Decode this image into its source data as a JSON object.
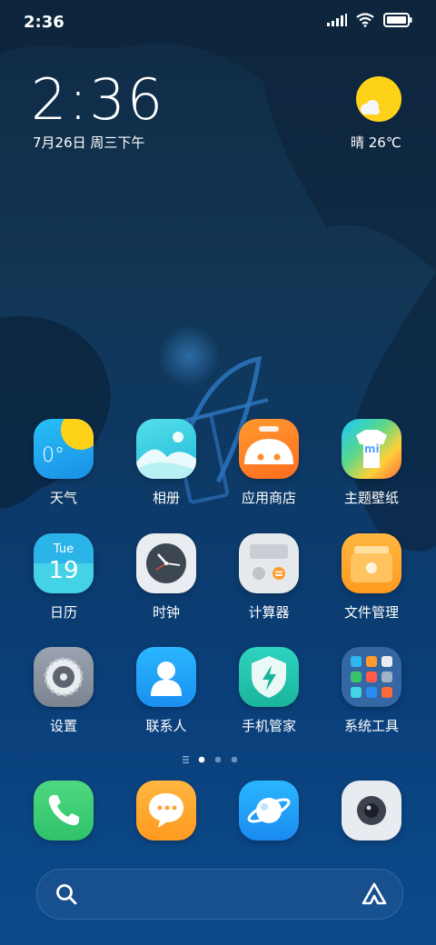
{
  "status": {
    "time": "2:36"
  },
  "clock": {
    "time": "2:36",
    "date": "7月26日 周三下午"
  },
  "weather": {
    "text": "晴 26℃",
    "icon": "sun-icon"
  },
  "apps": [
    {
      "label": "天气",
      "icon": "weather-icon",
      "glyph": "0°"
    },
    {
      "label": "相册",
      "icon": "gallery-icon"
    },
    {
      "label": "应用商店",
      "icon": "app-store-icon"
    },
    {
      "label": "主题壁纸",
      "icon": "themes-icon",
      "glyph": "mi"
    },
    {
      "label": "日历",
      "icon": "calendar-icon",
      "day": "Tue",
      "date": "19"
    },
    {
      "label": "时钟",
      "icon": "clock-icon"
    },
    {
      "label": "计算器",
      "icon": "calculator-icon"
    },
    {
      "label": "文件管理",
      "icon": "file-manager-icon"
    },
    {
      "label": "设置",
      "icon": "settings-icon"
    },
    {
      "label": "联系人",
      "icon": "contacts-icon"
    },
    {
      "label": "手机管家",
      "icon": "security-icon"
    },
    {
      "label": "系统工具",
      "icon": "system-tools-folder-icon"
    }
  ],
  "dock": [
    {
      "icon": "phone-icon"
    },
    {
      "icon": "messages-icon"
    },
    {
      "icon": "browser-icon"
    },
    {
      "icon": "camera-icon"
    }
  ],
  "search": {
    "icon": "search-icon",
    "assistant_icon": "assistant-icon"
  }
}
